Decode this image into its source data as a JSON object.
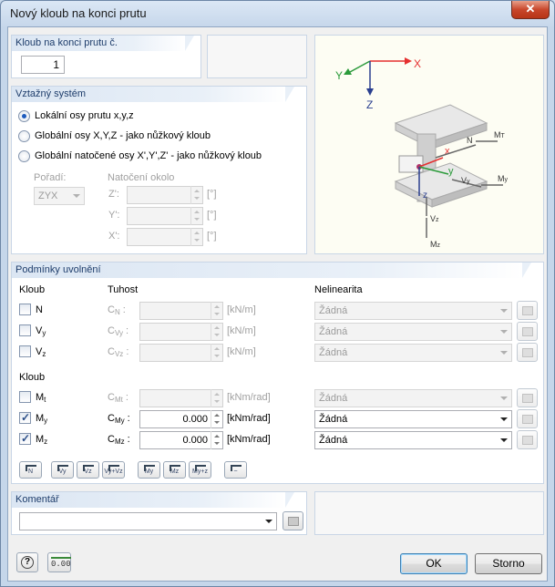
{
  "window": {
    "title": "Nový kloub na konci prutu",
    "close": "✕"
  },
  "hinge_number": {
    "label": "Kloub na konci prutu č.",
    "value": "1"
  },
  "reference": {
    "label": "Vztažný systém",
    "options": [
      "Lokální osy prutu x,y,z",
      "Globální osy X,Y,Z - jako nůžkový kloub",
      "Globální natočené osy X',Y',Z' - jako nůžkový kloub"
    ],
    "order_label": "Pořadí:",
    "order_value": "ZYX",
    "rotation_label": "Natočení okolo",
    "rows": [
      {
        "axis": "Z':",
        "unit": "[°]"
      },
      {
        "axis": "Y':",
        "unit": "[°]"
      },
      {
        "axis": "X':",
        "unit": "[°]"
      }
    ]
  },
  "release": {
    "label": "Podmínky uvolnění",
    "col_hinge": "Kloub",
    "col_stiffness": "Tuhost",
    "col_nonlin": "Nelinearita",
    "hinge2_label": "Kloub",
    "rows": [
      {
        "name": "N",
        "sub": "",
        "c": "C",
        "csub": "N",
        "value": "",
        "unit": "[kN/m]",
        "nonlin": "Žádná",
        "checked": false
      },
      {
        "name": "V",
        "sub": "y",
        "c": "C",
        "csub": "Vy",
        "value": "",
        "unit": "[kN/m]",
        "nonlin": "Žádná",
        "checked": false
      },
      {
        "name": "V",
        "sub": "z",
        "c": "C",
        "csub": "Vz",
        "value": "",
        "unit": "[kN/m]",
        "nonlin": "Žádná",
        "checked": false
      },
      {
        "name": "M",
        "sub": "t",
        "c": "C",
        "csub": "Mt",
        "value": "",
        "unit": "[kNm/rad]",
        "nonlin": "Žádná",
        "checked": false
      },
      {
        "name": "M",
        "sub": "y",
        "c": "C",
        "csub": "My",
        "value": "0.000",
        "unit": "[kNm/rad]",
        "nonlin": "Žádná",
        "checked": true
      },
      {
        "name": "M",
        "sub": "z",
        "c": "C",
        "csub": "Mz",
        "value": "0.000",
        "unit": "[kNm/rad]",
        "nonlin": "Žádná",
        "checked": true
      }
    ],
    "buttons": [
      "N",
      "Vy",
      "Vz",
      "Vy+Vz",
      "My",
      "Mz",
      "My+z",
      "~"
    ]
  },
  "comment": {
    "label": "Komentář",
    "value": ""
  },
  "footer": {
    "ok": "OK",
    "cancel": "Storno",
    "units_icon": "0.00"
  },
  "picture": {
    "axes": {
      "X": "X",
      "Y": "Y",
      "Z": "Z"
    },
    "local": {
      "x": "x",
      "y": "y",
      "z": "z"
    },
    "labels": {
      "N": "N",
      "MT": "M",
      "MTsub": "T",
      "Vy": "V",
      "Vysub": "y",
      "My": "M",
      "Mysub": "y",
      "Vz": "V",
      "Vzsub": "z",
      "Mz": "M",
      "Mzsub": "z"
    }
  },
  "colors": {
    "x_axis": "#e53030",
    "y_axis": "#2a9a3a",
    "z_axis": "#2a3f8f"
  }
}
